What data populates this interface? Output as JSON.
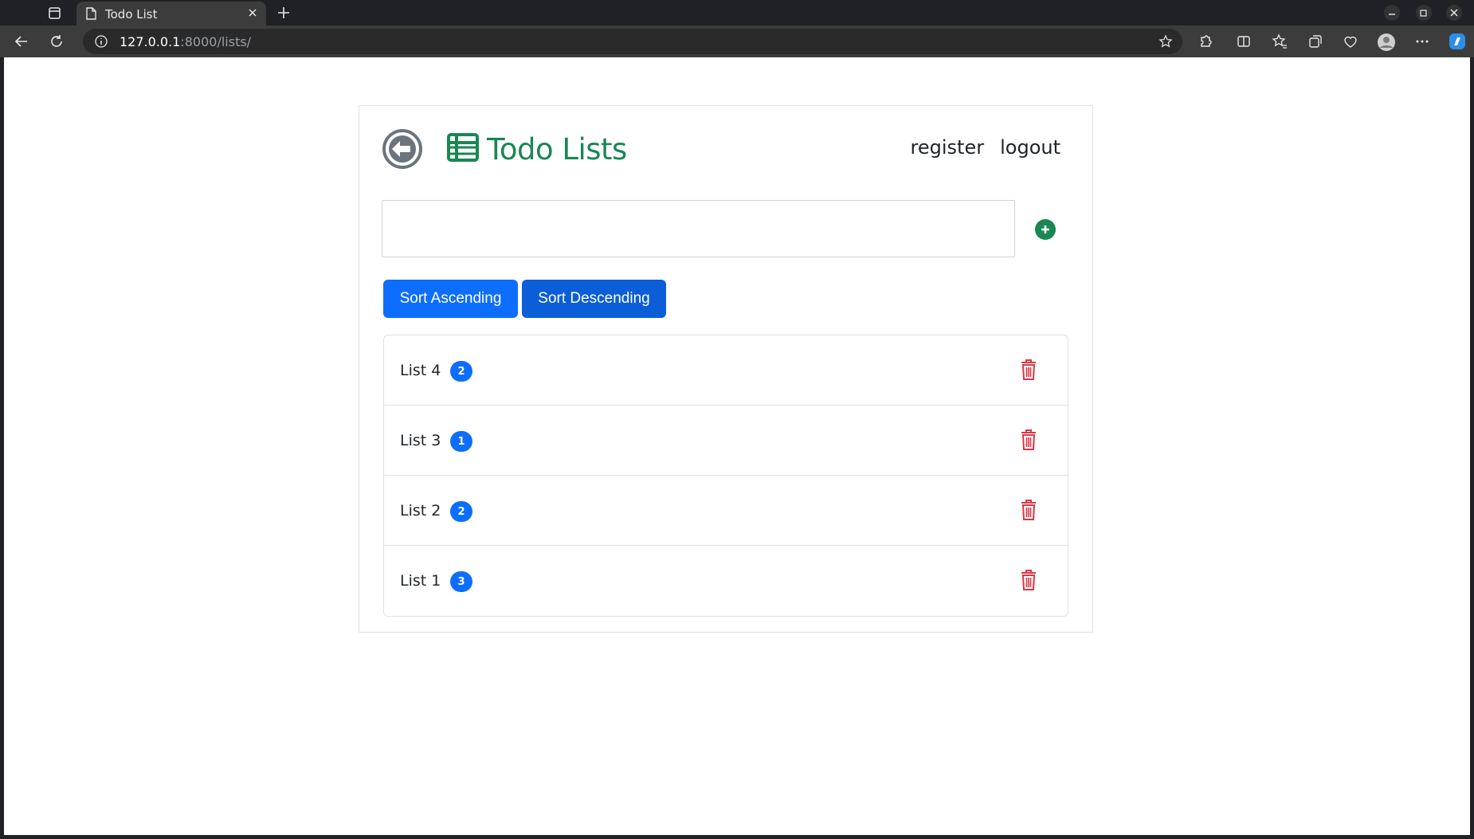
{
  "browser": {
    "tab_title": "Todo List",
    "url_host": "127.0.0.1",
    "url_rest": ":8000/lists/"
  },
  "page": {
    "title": "Todo Lists",
    "nav": {
      "register": "register",
      "logout": "logout"
    },
    "new_list_input": {
      "value": "",
      "placeholder": ""
    },
    "sort_ascending_label": "Sort Ascending",
    "sort_descending_label": "Sort Descending",
    "lists": [
      {
        "name": "List 4",
        "count": "2"
      },
      {
        "name": "List 3",
        "count": "1"
      },
      {
        "name": "List 2",
        "count": "2"
      },
      {
        "name": "List 1",
        "count": "3"
      }
    ]
  },
  "colors": {
    "brand_green": "#198754",
    "primary_blue": "#0d6efd",
    "danger_red": "#dc3545",
    "back_icon_gray": "#6c757d"
  },
  "icons": {
    "back": "arrow-left-circle-icon",
    "title": "table-list-icon",
    "add": "plus-circle-icon",
    "delete": "trash-icon"
  }
}
